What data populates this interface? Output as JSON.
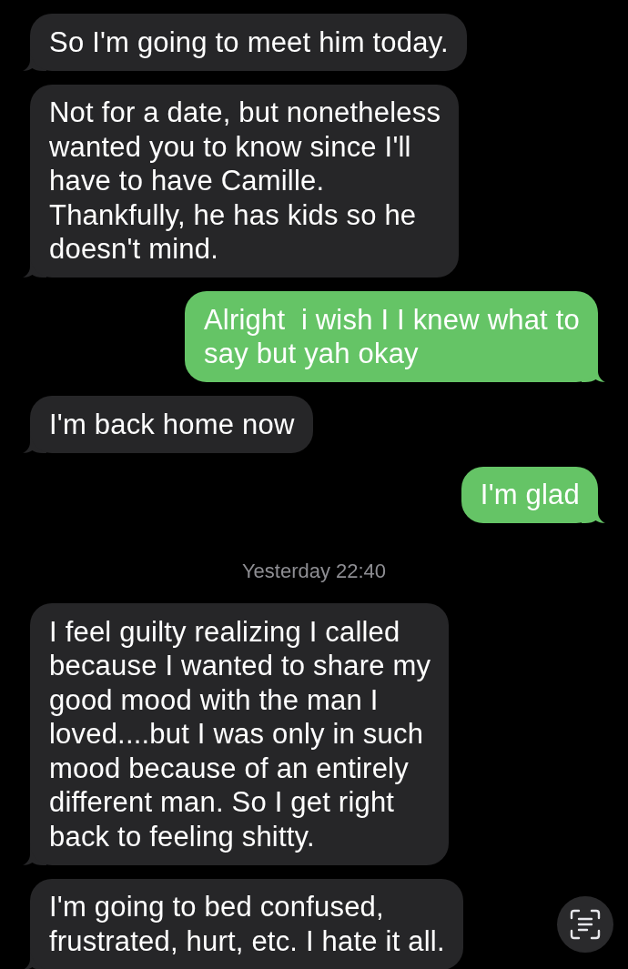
{
  "messages": [
    {
      "kind": "incoming",
      "lines": [
        "So I'm going to meet him today."
      ]
    },
    {
      "kind": "incoming",
      "lines": [
        "Not for a date, but nonetheless",
        "wanted you to know since I'll",
        "have to have Camille.",
        "Thankfully, he has kids so he",
        "doesn't mind."
      ]
    },
    {
      "kind": "outgoing",
      "lines": [
        "Alright  i wish I I knew what to",
        "say but yah okay"
      ]
    },
    {
      "kind": "incoming",
      "lines": [
        "I'm back home now"
      ]
    },
    {
      "kind": "outgoing",
      "lines": [
        "I'm glad"
      ]
    },
    {
      "kind": "timestamp",
      "text": "Yesterday 22:40"
    },
    {
      "kind": "incoming",
      "lines": [
        "I feel guilty realizing I called",
        "because I wanted to share my",
        "good mood with the man I",
        "loved....but I was only in such",
        "mood because of an entirely",
        "different man. So I get right",
        "back to feeling shitty."
      ]
    },
    {
      "kind": "incoming",
      "lines": [
        "I'm going to bed confused,",
        "frustrated, hurt, etc. I hate it all."
      ]
    }
  ]
}
